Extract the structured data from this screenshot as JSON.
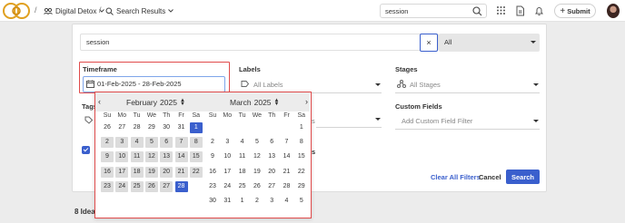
{
  "header": {
    "workspace": "Digital Detox",
    "page": "Search Results",
    "search_value": "session",
    "submit_label": "Submit"
  },
  "filters": {
    "query": "session",
    "clear_symbol": "×",
    "scope": "All",
    "timeframe_label": "Timeframe",
    "timeframe_value": "01-Feb-2025 - 28-Feb-2025",
    "labels_label": "Labels",
    "labels_placeholder": "All Labels",
    "stages_label": "Stages",
    "stages_placeholder": "All Stages",
    "tags_label": "Tags",
    "custom_fields_label": "Custom Fields",
    "custom_fields_placeholder": "Add Custom Field Filter",
    "hidden_field_tail": "s",
    "checkbox_tail": "s",
    "clear_all": "Clear All Filters",
    "cancel": "Cancel",
    "search": "Search"
  },
  "results": {
    "count_label": "8 Idea"
  },
  "calendar": {
    "prev": "‹",
    "next": "›",
    "weekdays": [
      "Su",
      "Mo",
      "Tu",
      "We",
      "Th",
      "Fr",
      "Sa"
    ],
    "months": [
      {
        "name": "February",
        "year": "2025",
        "rows": [
          [
            "26",
            "27",
            "28",
            "29",
            "30",
            "31",
            "1"
          ],
          [
            "2",
            "3",
            "4",
            "5",
            "6",
            "7",
            "8"
          ],
          [
            "9",
            "10",
            "11",
            "12",
            "13",
            "14",
            "15"
          ],
          [
            "16",
            "17",
            "18",
            "19",
            "20",
            "21",
            "22"
          ],
          [
            "23",
            "24",
            "25",
            "26",
            "27",
            "28",
            ""
          ]
        ]
      },
      {
        "name": "March",
        "year": "2025",
        "rows": [
          [
            "",
            "",
            "",
            "",
            "",
            "",
            "1"
          ],
          [
            "2",
            "3",
            "4",
            "5",
            "6",
            "7",
            "8"
          ],
          [
            "9",
            "10",
            "11",
            "12",
            "13",
            "14",
            "15"
          ],
          [
            "16",
            "17",
            "18",
            "19",
            "20",
            "21",
            "22"
          ],
          [
            "23",
            "24",
            "25",
            "26",
            "27",
            "28",
            "29"
          ],
          [
            "30",
            "31",
            "1",
            "2",
            "3",
            "4",
            "5"
          ]
        ]
      }
    ]
  },
  "colors": {
    "accent": "#3a5fcd",
    "highlight": "#e04b4b",
    "range": "#dcdcdc"
  }
}
